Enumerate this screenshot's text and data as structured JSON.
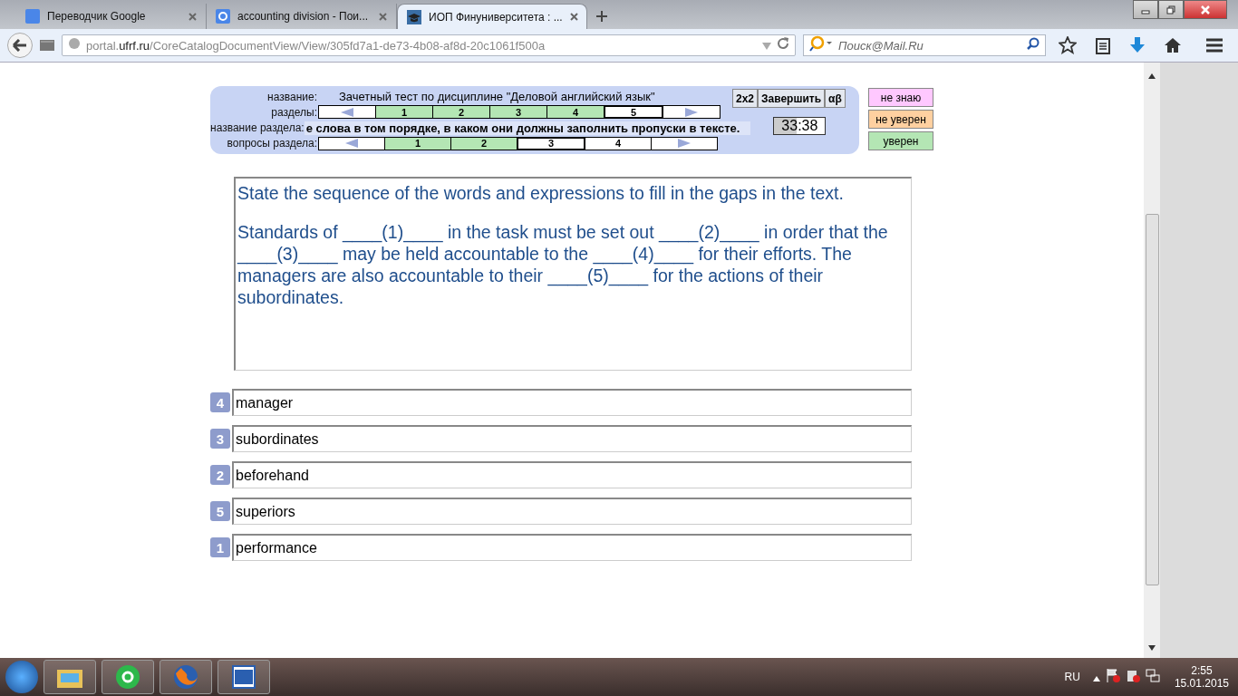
{
  "browser": {
    "tabs": [
      {
        "title": "Переводчик Google",
        "selected": false
      },
      {
        "title": "accounting division - Пои...",
        "selected": false
      },
      {
        "title": "ИОП Финуниверситета : ...",
        "selected": true
      }
    ],
    "url": {
      "prefix": "portal.",
      "domain": "ufrf.ru",
      "path": "/CoreCatalogDocumentView/View/305fd7a1-de73-4b08-af8d-20c1061f500a"
    },
    "search": {
      "placeholder": "Поиск@Mail.Ru"
    }
  },
  "test": {
    "labels": {
      "title": "название:",
      "sections": "разделы:",
      "section_name": "название раздела:",
      "questions": "вопросы раздела:"
    },
    "title": "Зачетный тест по дисциплине \"Деловой английский язык\"",
    "sections": [
      {
        "label": "1",
        "answered": true,
        "selected": false
      },
      {
        "label": "2",
        "answered": true,
        "selected": false
      },
      {
        "label": "3",
        "answered": true,
        "selected": false
      },
      {
        "label": "4",
        "answered": true,
        "selected": false
      },
      {
        "label": "5",
        "answered": false,
        "selected": true
      }
    ],
    "section_name": "е слова в том порядке, в каком они должны заполнить пропуски в тексте.",
    "questions": [
      {
        "label": "1",
        "answered": true,
        "selected": false
      },
      {
        "label": "2",
        "answered": true,
        "selected": false
      },
      {
        "label": "3",
        "answered": false,
        "selected": true
      },
      {
        "label": "4",
        "answered": false,
        "selected": false
      }
    ],
    "buttons": [
      "2x2",
      "Завершить",
      "αβ"
    ],
    "timer": "33:38",
    "confidence": [
      {
        "label": "не знаю",
        "color": "#ffc8ff"
      },
      {
        "label": "не уверен",
        "color": "#ffd0a0"
      },
      {
        "label": "уверен",
        "color": "#b4e6b4"
      }
    ]
  },
  "question": {
    "instruction": "State the sequence of the words and expressions to fill in the gaps in the text.",
    "text": "Standards of ____(1)____ in the task must be set out ____(2)____ in order that the ____(3)____ may be held accountable to the ____(4)____ for their efforts. The managers are also accountable to their ____(5)____ for the actions of their subordinates."
  },
  "answers": [
    {
      "number": "4",
      "text": "manager"
    },
    {
      "number": "3",
      "text": "subordinates"
    },
    {
      "number": "2",
      "text": "beforehand"
    },
    {
      "number": "5",
      "text": "superiors"
    },
    {
      "number": "1",
      "text": "performance"
    }
  ],
  "taskbar": {
    "language": "RU",
    "time": "2:55",
    "date": "15.01.2015"
  }
}
